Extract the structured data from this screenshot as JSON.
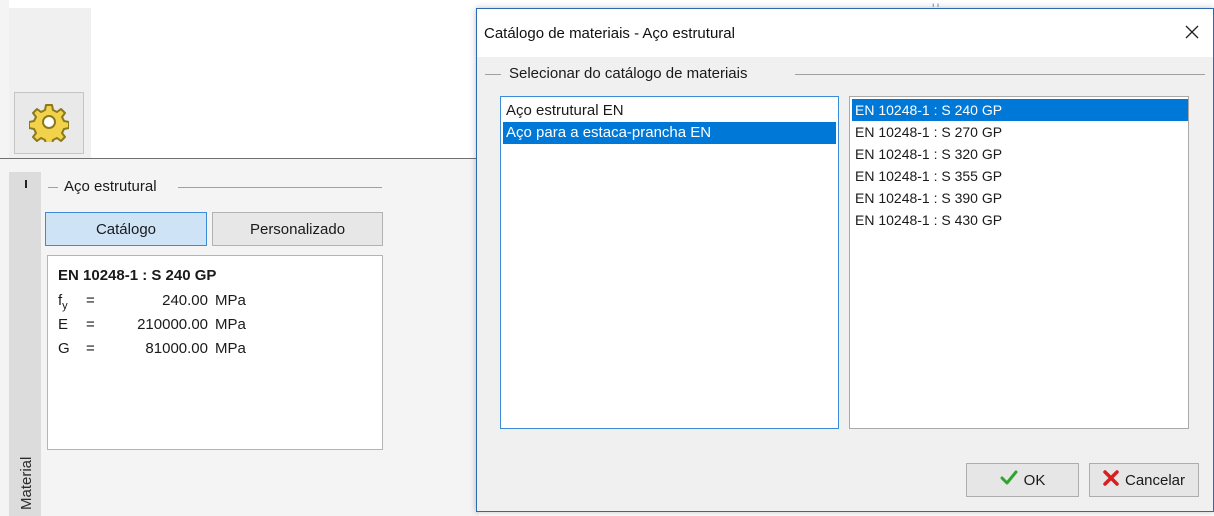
{
  "app": {
    "settings_icon": "gear-icon",
    "vertical_tab": "Material",
    "group_title": "Aço estrutural",
    "tabs": [
      {
        "label": "Catálogo",
        "active": true
      },
      {
        "label": "Personalizado",
        "active": false
      }
    ],
    "material": {
      "name": "EN 10248-1 : S 240 GP",
      "properties": [
        {
          "symbol": "f",
          "subscript": "y",
          "value": "240.00",
          "unit": "MPa"
        },
        {
          "symbol": "E",
          "subscript": "",
          "value": "210000.00",
          "unit": "MPa"
        },
        {
          "symbol": "G",
          "subscript": "",
          "value": "81000.00",
          "unit": "MPa"
        }
      ]
    }
  },
  "dialog": {
    "title": "Catálogo de materiais - Aço estrutural",
    "group_title": "Selecionar do catálogo de materiais",
    "catalogs": [
      "Aço estrutural EN",
      "Aço para a estaca-prancha EN"
    ],
    "selected_catalog": 1,
    "materials": [
      "EN 10248-1 : S 240 GP",
      "EN 10248-1 : S 270 GP",
      "EN 10248-1 : S 320 GP",
      "EN 10248-1 : S 355 GP",
      "EN 10248-1 : S 390 GP",
      "EN 10248-1 : S 430 GP"
    ],
    "selected_material": 0,
    "ok_label": "OK",
    "cancel_label": "Cancelar"
  },
  "colors": {
    "accent": "#0078d7",
    "active_tab_bg": "#cfe3f7",
    "ok_check": "#2fa52f",
    "cancel_x": "#d62020"
  }
}
